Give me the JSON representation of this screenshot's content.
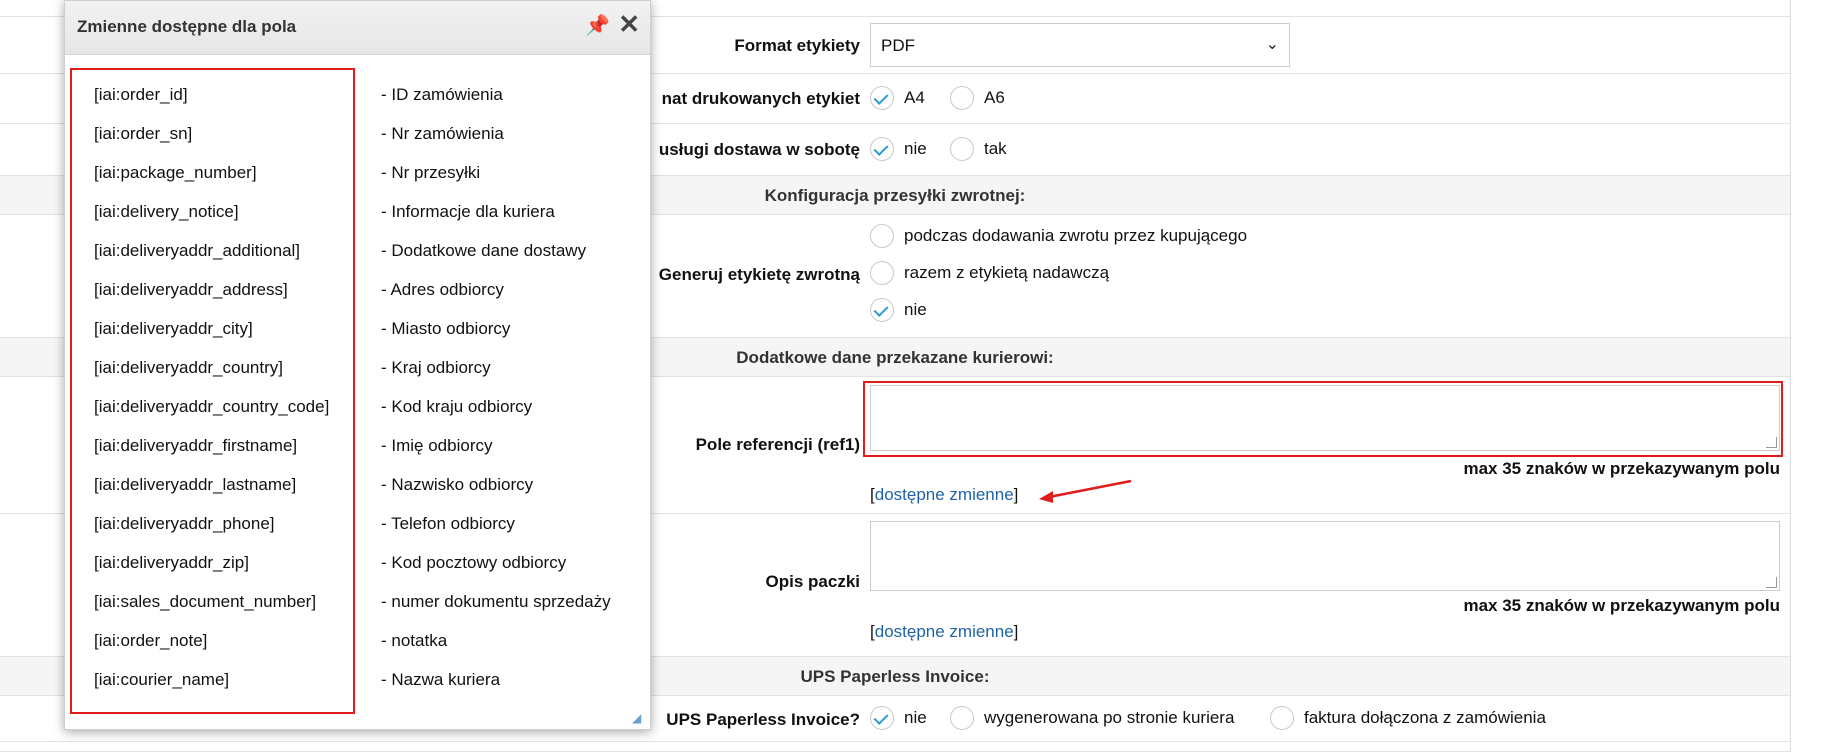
{
  "form": {
    "label_format": "Format etykiety",
    "format_value": "PDF",
    "label_print_format": "nat drukowanych etykiet",
    "print_options": [
      "A4",
      "A6"
    ],
    "label_saturday": "usługi dostawa w sobotę",
    "saturday_options": [
      "nie",
      "tak"
    ],
    "section_return": "Konfiguracja przesyłki zwrotnej:",
    "label_return": "Generuj etykietę zwrotną",
    "return_options": [
      "podczas dodawania zwrotu przez kupującego",
      "razem z etykietą nadawczą",
      "nie"
    ],
    "section_extra": "Dodatkowe dane przekazane kurierowi:",
    "label_ref": "Pole referencji (ref1)",
    "max_note": "max 35 znaków w przekazywanym polu",
    "vars_link": "dostępne zmienne",
    "label_desc": "Opis paczki",
    "section_ups": "UPS Paperless Invoice:",
    "label_ups": "UPS Paperless Invoice?",
    "ups_options": [
      "nie",
      "wygenerowana po stronie kuriera",
      "faktura dołączona z zamówienia"
    ]
  },
  "popup": {
    "title": "Zmienne dostępne dla pola",
    "variables": [
      {
        "key": "[iai:order_id]",
        "desc": "- ID zamówienia"
      },
      {
        "key": "[iai:order_sn]",
        "desc": "- Nr zamówienia"
      },
      {
        "key": "[iai:package_number]",
        "desc": "- Nr przesyłki"
      },
      {
        "key": "[iai:delivery_notice]",
        "desc": "- Informacje dla kuriera"
      },
      {
        "key": "[iai:deliveryaddr_additional]",
        "desc": "- Dodatkowe dane dostawy"
      },
      {
        "key": "[iai:deliveryaddr_address]",
        "desc": "- Adres odbiorcy"
      },
      {
        "key": "[iai:deliveryaddr_city]",
        "desc": "- Miasto odbiorcy"
      },
      {
        "key": "[iai:deliveryaddr_country]",
        "desc": "- Kraj odbiorcy"
      },
      {
        "key": "[iai:deliveryaddr_country_code]",
        "desc": "- Kod kraju odbiorcy"
      },
      {
        "key": "[iai:deliveryaddr_firstname]",
        "desc": "- Imię odbiorcy"
      },
      {
        "key": "[iai:deliveryaddr_lastname]",
        "desc": "- Nazwisko odbiorcy"
      },
      {
        "key": "[iai:deliveryaddr_phone]",
        "desc": "- Telefon odbiorcy"
      },
      {
        "key": "[iai:deliveryaddr_zip]",
        "desc": "- Kod pocztowy odbiorcy"
      },
      {
        "key": "[iai:sales_document_number]",
        "desc": "- numer dokumentu sprzedaży"
      },
      {
        "key": "[iai:order_note]",
        "desc": "- notatka"
      },
      {
        "key": "[iai:courier_name]",
        "desc": "- Nazwa kuriera"
      }
    ]
  },
  "colors": {
    "accent": "#2a9ad8",
    "highlight": "#e21b1b",
    "link": "#1f63a6"
  }
}
